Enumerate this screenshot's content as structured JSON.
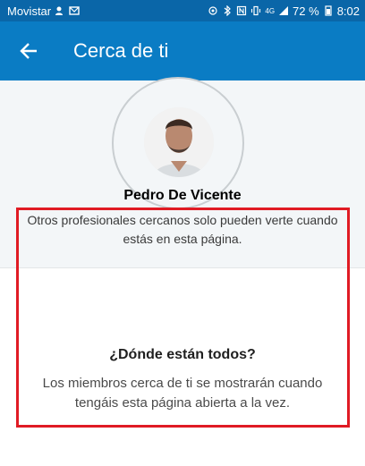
{
  "statusbar": {
    "carrier": "Movistar",
    "battery": "72 %",
    "time": "8:02",
    "network": "4G"
  },
  "appbar": {
    "title": "Cerca de ti",
    "back_icon": "arrow-left-icon"
  },
  "profile": {
    "name": "Pedro De Vicente",
    "description": "Otros profesionales cercanos solo pueden verte cuando estás en esta página."
  },
  "empty_state": {
    "title": "¿Dónde están todos?",
    "body": "Los miembros cerca de ti se mostrarán cuando tengáis esta página abierta a la vez."
  },
  "colors": {
    "status_bar": "#0a66a8",
    "app_bar": "#0a7cc4",
    "top_bg": "#f3f6f8",
    "highlight": "#e01b24"
  }
}
